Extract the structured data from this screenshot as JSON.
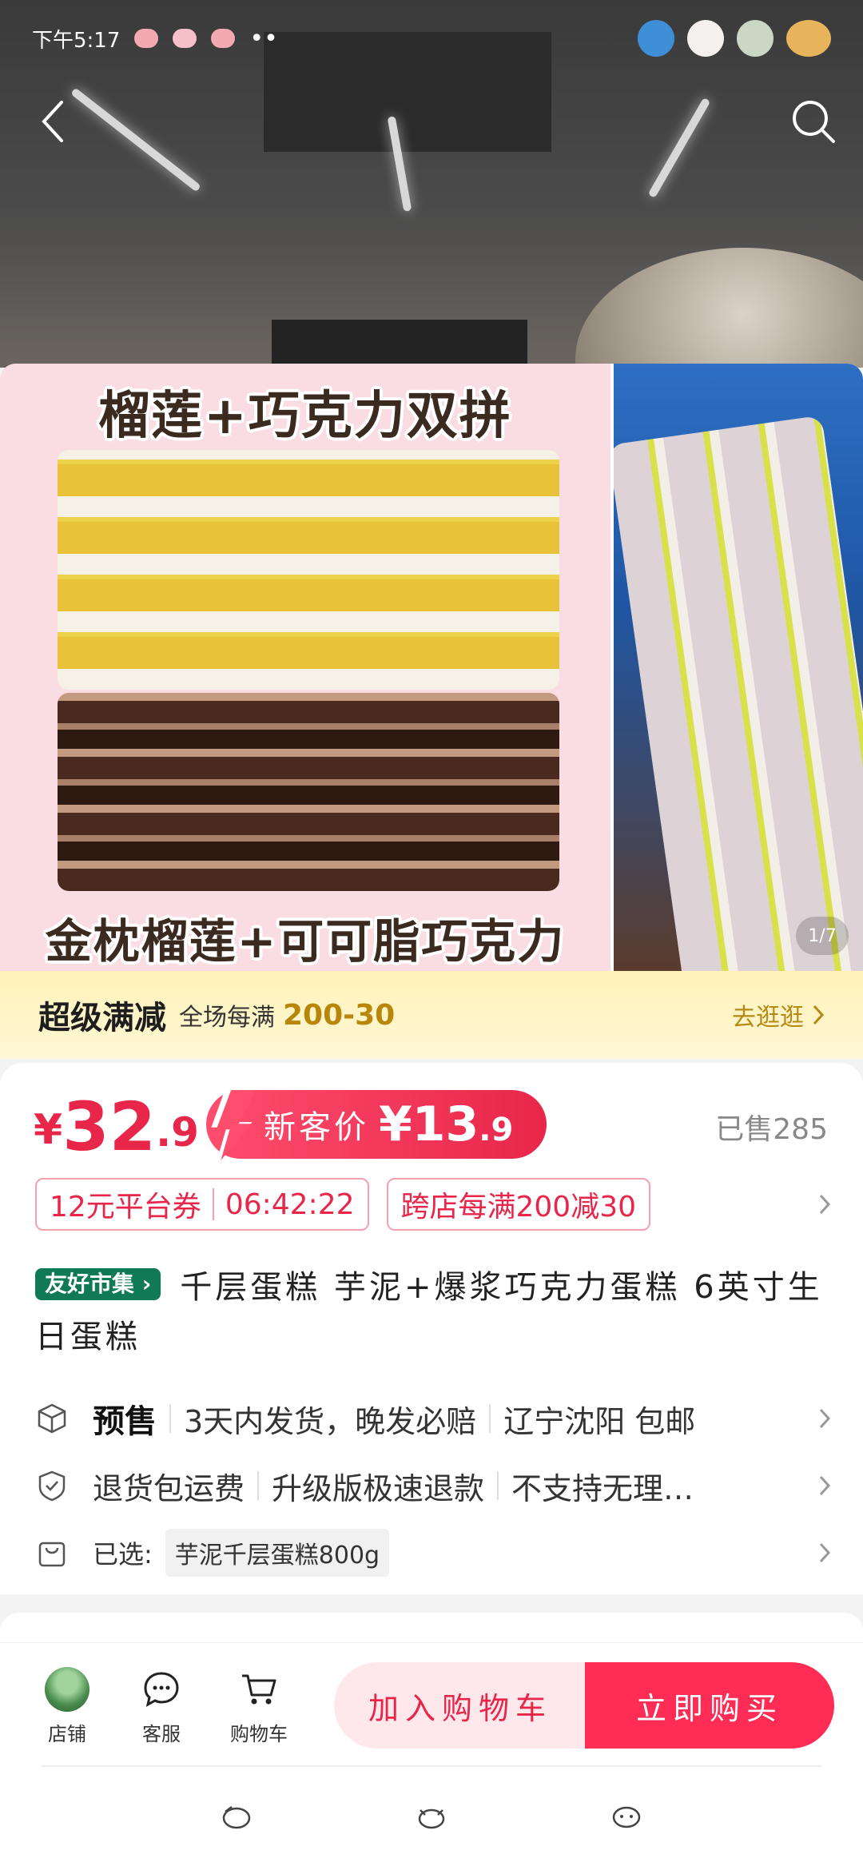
{
  "status_bar": {
    "time": "下午5:17"
  },
  "colors": {
    "accent": "#e8264a",
    "promo_gold": "#b8860b",
    "tag_green": "#0f7a55"
  },
  "carousel": {
    "headline_top": "榴莲+巧克力双拼",
    "headline_bottom": "金枕榴莲+可可脂巧克力",
    "pager": "1/7"
  },
  "promo": {
    "title": "超级满减",
    "desc": "全场每满",
    "amount": "200-30",
    "link": "去逛逛"
  },
  "price": {
    "symbol": "¥",
    "integer": "32",
    "decimal": ".9",
    "new_customer_label": "新客价",
    "new_customer_symbol": "¥",
    "new_customer_integer": "13",
    "new_customer_decimal": ".9",
    "sold": "已售285"
  },
  "coupons": {
    "platform": "12元平台券",
    "countdown": "06:42:22",
    "cross_store": "跨店每满200减30"
  },
  "product": {
    "tag": "友好市集",
    "title": "千层蛋糕 芋泥+爆浆巧克力蛋糕 6英寸生日蛋糕"
  },
  "specs": {
    "presale": "预售",
    "ship": "3天内发货，晚发必赔",
    "origin": "辽宁沈阳 包邮",
    "return_fee": "退货包运费",
    "refund": "升级版极速退款",
    "no_reason": "不支持无理…",
    "selected_label": "已选:",
    "selected_value": "芋泥千层蛋糕800g"
  },
  "actions": {
    "shop": "店铺",
    "service": "客服",
    "cart": "购物车",
    "add_to_cart": "加入购物车",
    "buy_now": "立即购买"
  }
}
